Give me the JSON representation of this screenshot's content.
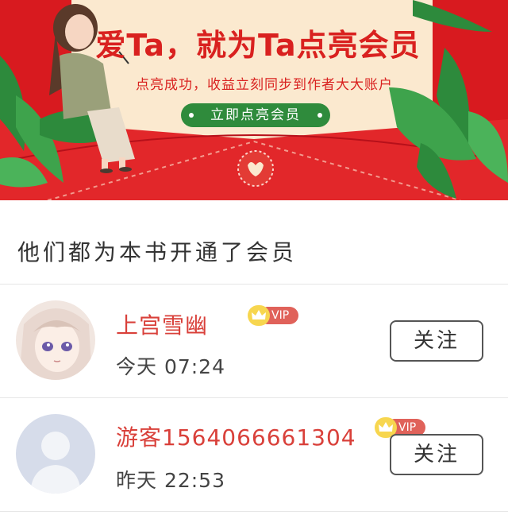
{
  "banner": {
    "title": "爱Ta，就为Ta点亮会员",
    "subtitle": "点亮成功，收益立刻同步到作者大大账户",
    "cta_label": "立即点亮会员"
  },
  "section": {
    "title": "他们都为本书开通了会员"
  },
  "members": [
    {
      "name": "上宫雪幽",
      "vip_label": "VIP",
      "time": "今天 07:24",
      "follow_label": "关注",
      "avatar": "anime-girl-avatar"
    },
    {
      "name": "游客1564066661304",
      "vip_label": "VIP",
      "time": "昨天 22:53",
      "follow_label": "关注",
      "avatar": "default-user-avatar"
    }
  ],
  "colors": {
    "banner_red": "#d81a1f",
    "name_red": "#d9403a",
    "cta_green": "#2f8b3c",
    "vip_badge": "#e0625a",
    "crown_gold": "#f7d64f"
  }
}
